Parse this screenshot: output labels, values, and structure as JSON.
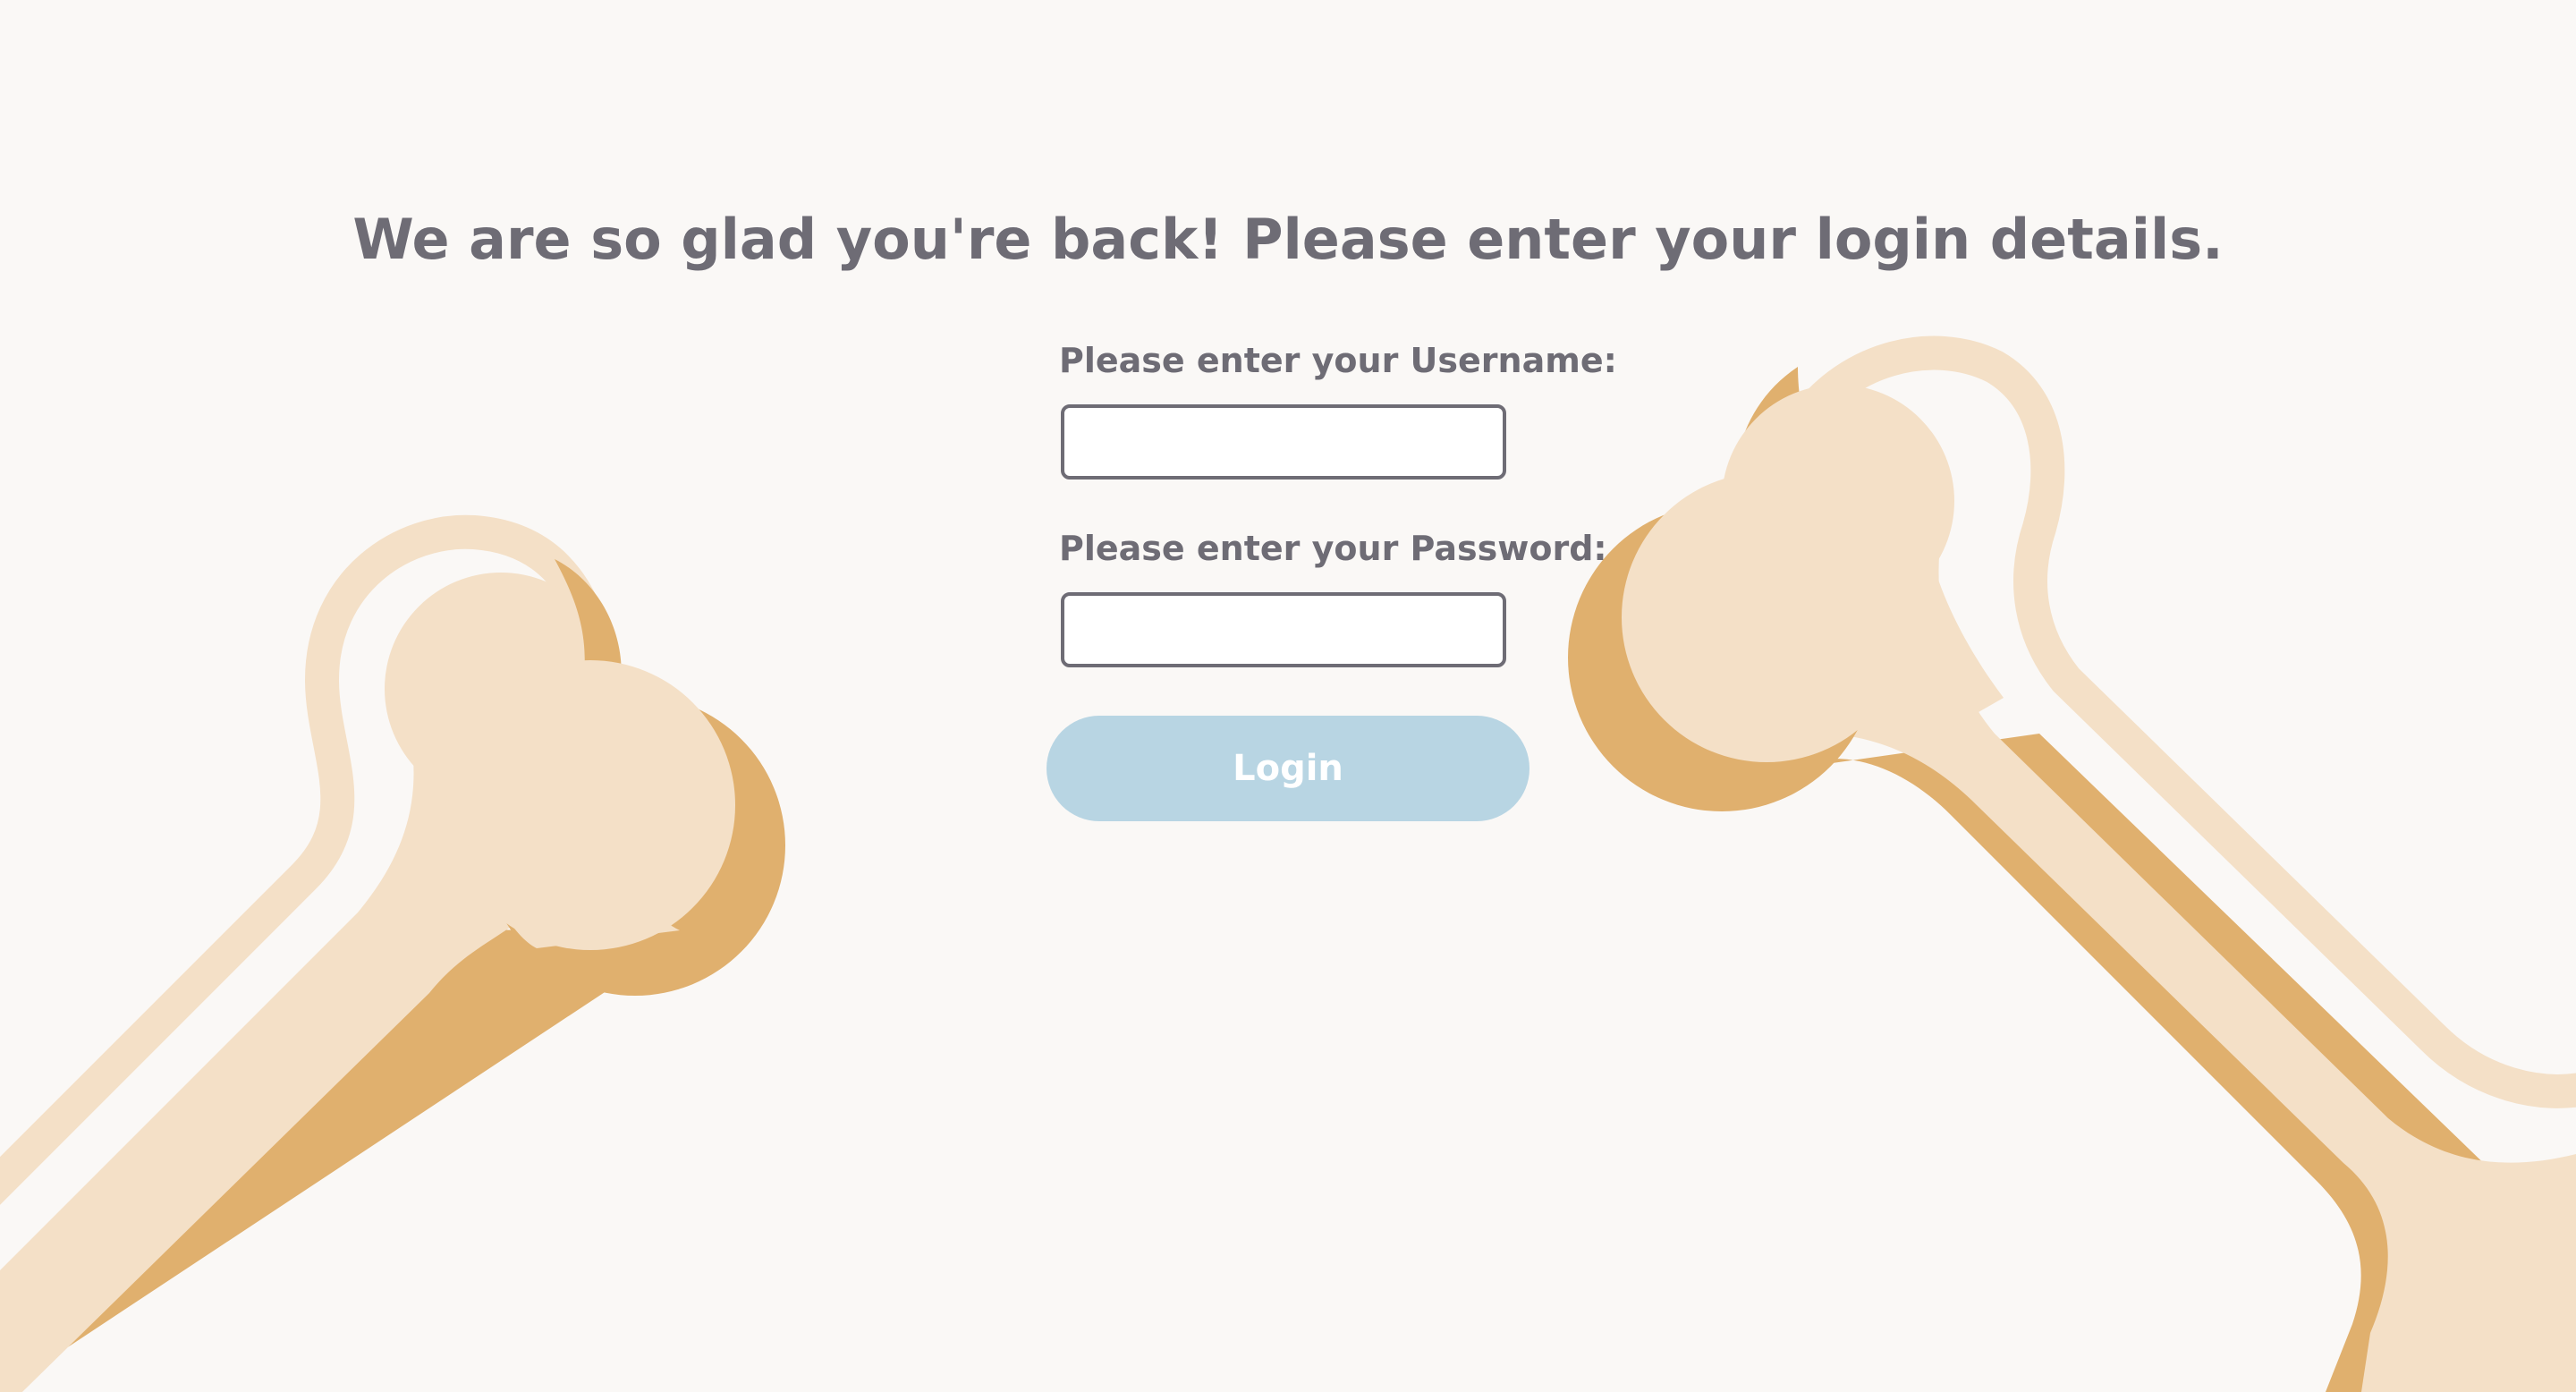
{
  "page": {
    "heading": "We are so glad you're back! Please enter your login details."
  },
  "login_form": {
    "username_label": "Please enter your Username:",
    "username_value": "",
    "password_label": "Please enter your Password:",
    "password_value": "",
    "login_button_label": "Login"
  },
  "colors": {
    "background": "#faf8f6",
    "text": "#6e6c75",
    "button_background": "#b8d5e3",
    "button_text": "#ffffff",
    "bone_light": "#f4e0c7",
    "bone_shadow": "#e0b06e"
  }
}
